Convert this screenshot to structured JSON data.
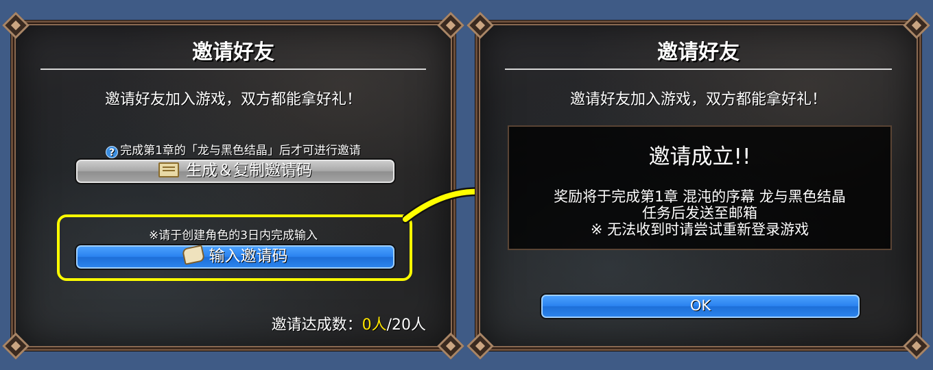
{
  "left_panel": {
    "title": "邀请好友",
    "subtitle": "邀请好友加入游戏，双方都能拿好礼！",
    "hint": "完成第1章的「龙与黑色结晶」后才可进行邀请",
    "generate_button": "生成＆复制邀请码",
    "note": "※请于创建角色的3日内完成输入",
    "enter_button": "输入邀请码",
    "count_label": "邀请达成数：",
    "count_current": "0人",
    "count_total": "/20人"
  },
  "right_panel": {
    "title": "邀请好友",
    "subtitle": "邀请好友加入游戏，双方都能拿好礼！",
    "result_title": "邀请成立!!",
    "result_line1": "奖励将于完成第1章 混沌的序幕 龙与黑色结晶",
    "result_line2": "任务后发送至邮箱",
    "result_line3": "※ 无法收到时请尝试重新登录游戏",
    "ok_button": "OK"
  },
  "colors": {
    "background": "#3f5b86",
    "highlight": "#ffff00",
    "count_current": "#ffe600",
    "button_blue": "#2b83f0",
    "button_gray": "#a9a9a9"
  },
  "icons": {
    "hint": "question-icon",
    "generate": "ticket-icon",
    "enter": "scroll-icon",
    "arrow": "arrow-icon"
  }
}
